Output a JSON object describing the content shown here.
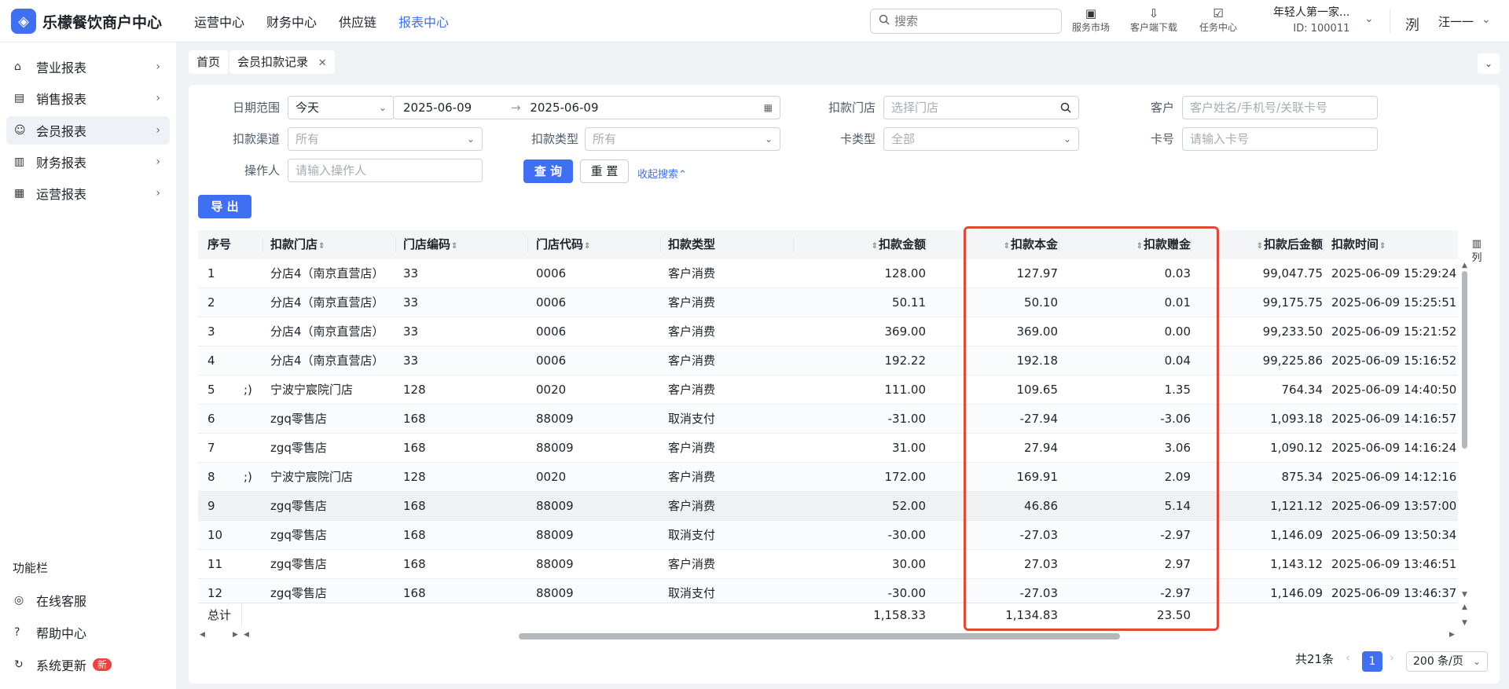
{
  "app": {
    "title": "乐檬餐饮商户中心",
    "logo_glyph": "◈"
  },
  "nav": [
    "运营中心",
    "财务中心",
    "供应链",
    "报表中心"
  ],
  "nav_active": 3,
  "search": {
    "placeholder": "搜索"
  },
  "tools": [
    {
      "label": "服务市场",
      "icon": "shop-icon"
    },
    {
      "label": "客户端下载",
      "icon": "download-icon"
    },
    {
      "label": "任务中心",
      "icon": "task-icon"
    }
  ],
  "account": {
    "org": "年轻人第一家...",
    "id": "ID: 100011",
    "avatar": "洌",
    "user": "汪一一"
  },
  "sidebar": {
    "items": [
      {
        "label": "营业报表",
        "icon": "store-icon"
      },
      {
        "label": "销售报表",
        "icon": "bank-icon"
      },
      {
        "label": "会员报表",
        "icon": "user-icon"
      },
      {
        "label": "财务报表",
        "icon": "ledger-icon"
      },
      {
        "label": "运营报表",
        "icon": "briefcase-icon"
      }
    ],
    "active": 2,
    "section_title": "功能栏",
    "func": [
      {
        "label": "在线客服",
        "icon": "support-icon"
      },
      {
        "label": "帮助中心",
        "icon": "help-icon"
      },
      {
        "label": "系统更新",
        "icon": "refresh-icon",
        "badge": "新"
      }
    ]
  },
  "tabs": {
    "home": "首页",
    "current": "会员扣款记录"
  },
  "filters": {
    "date_range_label": "日期范围",
    "date_preset": "今天",
    "date_start": "2025-06-09",
    "date_end": "2025-06-09",
    "store_label": "扣款门店",
    "store_placeholder": "选择门店",
    "customer_label": "客户",
    "customer_placeholder": "客户姓名/手机号/关联卡号",
    "channel_label": "扣款渠道",
    "channel_value": "所有",
    "type_label": "扣款类型",
    "type_value": "所有",
    "card_type_label": "卡类型",
    "card_type_value": "全部",
    "card_no_label": "卡号",
    "card_no_placeholder": "请输入卡号",
    "operator_label": "操作人",
    "operator_placeholder": "请输入操作人",
    "query_btn": "查 询",
    "reset_btn": "重 置",
    "collapse_link": "收起搜索",
    "export_btn": "导 出"
  },
  "table": {
    "headers": [
      "序号",
      "扣款门店",
      "门店编码",
      "门店代码",
      "扣款类型",
      "扣款金额",
      "扣款本金",
      "扣款赠金",
      "扣款后金额",
      "扣款时间"
    ],
    "rows": [
      {
        "no": "1",
        "pre": "",
        "store": "分店4（南京直营店）",
        "code": "33",
        "scode": "0006",
        "type": "客户消费",
        "amount": "128.00",
        "principal": "127.97",
        "gift": "0.03",
        "after": "99,047.75",
        "time": "2025-06-09 15:29:24"
      },
      {
        "no": "2",
        "pre": "",
        "store": "分店4（南京直营店）",
        "code": "33",
        "scode": "0006",
        "type": "客户消费",
        "amount": "50.11",
        "principal": "50.10",
        "gift": "0.01",
        "after": "99,175.75",
        "time": "2025-06-09 15:25:51"
      },
      {
        "no": "3",
        "pre": "",
        "store": "分店4（南京直营店）",
        "code": "33",
        "scode": "0006",
        "type": "客户消费",
        "amount": "369.00",
        "principal": "369.00",
        "gift": "0.00",
        "after": "99,233.50",
        "time": "2025-06-09 15:21:52"
      },
      {
        "no": "4",
        "pre": "",
        "store": "分店4（南京直营店）",
        "code": "33",
        "scode": "0006",
        "type": "客户消费",
        "amount": "192.22",
        "principal": "192.18",
        "gift": "0.04",
        "after": "99,225.86",
        "time": "2025-06-09 15:16:52"
      },
      {
        "no": "5",
        "pre": ";)",
        "store": "宁波宁宸院门店",
        "code": "128",
        "scode": "0020",
        "type": "客户消费",
        "amount": "111.00",
        "principal": "109.65",
        "gift": "1.35",
        "after": "764.34",
        "time": "2025-06-09 14:40:50"
      },
      {
        "no": "6",
        "pre": "",
        "store": "zgq零售店",
        "code": "168",
        "scode": "88009",
        "type": "取消支付",
        "amount": "-31.00",
        "principal": "-27.94",
        "gift": "-3.06",
        "after": "1,093.18",
        "time": "2025-06-09 14:16:57"
      },
      {
        "no": "7",
        "pre": "",
        "store": "zgq零售店",
        "code": "168",
        "scode": "88009",
        "type": "客户消费",
        "amount": "31.00",
        "principal": "27.94",
        "gift": "3.06",
        "after": "1,090.12",
        "time": "2025-06-09 14:16:24"
      },
      {
        "no": "8",
        "pre": ";)",
        "store": "宁波宁宸院门店",
        "code": "128",
        "scode": "0020",
        "type": "客户消费",
        "amount": "172.00",
        "principal": "169.91",
        "gift": "2.09",
        "after": "875.34",
        "time": "2025-06-09 14:12:16"
      },
      {
        "no": "9",
        "pre": "",
        "store": "zgq零售店",
        "code": "168",
        "scode": "88009",
        "type": "客户消费",
        "amount": "52.00",
        "principal": "46.86",
        "gift": "5.14",
        "after": "1,121.12",
        "time": "2025-06-09 13:57:00"
      },
      {
        "no": "10",
        "pre": "",
        "store": "zgq零售店",
        "code": "168",
        "scode": "88009",
        "type": "取消支付",
        "amount": "-30.00",
        "principal": "-27.03",
        "gift": "-2.97",
        "after": "1,146.09",
        "time": "2025-06-09 13:50:34"
      },
      {
        "no": "11",
        "pre": "",
        "store": "zgq零售店",
        "code": "168",
        "scode": "88009",
        "type": "客户消费",
        "amount": "30.00",
        "principal": "27.03",
        "gift": "2.97",
        "after": "1,143.12",
        "time": "2025-06-09 13:46:51"
      },
      {
        "no": "12",
        "pre": "",
        "store": "zgq零售店",
        "code": "168",
        "scode": "88009",
        "type": "取消支付",
        "amount": "-30.00",
        "principal": "-27.03",
        "gift": "-2.97",
        "after": "1,146.09",
        "time": "2025-06-09 13:46:37"
      }
    ],
    "selected_row": 8,
    "total": {
      "label": "总计",
      "amount": "1,158.33",
      "principal": "1,134.83",
      "gift": "23.50"
    },
    "column_menu": "列"
  },
  "pagination": {
    "total_text": "共21条",
    "current": "1",
    "page_size": "200 条/页"
  },
  "colors": {
    "accent": "#3f6ff2",
    "highlight": "#e04a36",
    "badge": "#f53f3f"
  }
}
